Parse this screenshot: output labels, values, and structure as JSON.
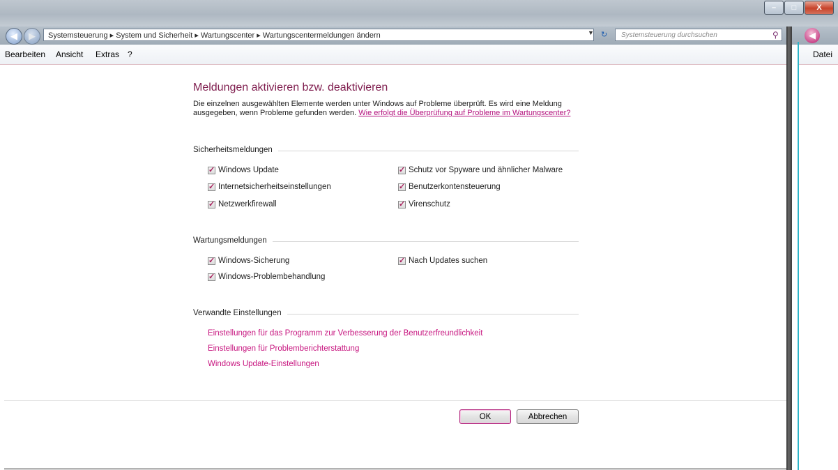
{
  "window": {
    "address_text": "Systemsteuerung  ▸  System und Sicherheit  ▸  Wartungscenter  ▸  Wartungscentermeldungen ändern",
    "search_placeholder": "Systemsteuerung durchsuchen",
    "controls": [
      "–",
      "□",
      "X"
    ]
  },
  "menubar": {
    "items": [
      "Bearbeiten",
      "Ansicht",
      "Extras",
      "?"
    ]
  },
  "right_pane": {
    "menu_label": "Datei"
  },
  "page": {
    "heading": "Meldungen aktivieren bzw. deaktivieren",
    "description": "Die einzelnen ausgewählten Elemente werden unter Windows auf Probleme überprüft. Es wird eine Meldung ausgegeben, wenn Probleme gefunden werden.",
    "help_link": "Wie erfolgt die Überprüfung auf Probleme im Wartungscenter?"
  },
  "security": {
    "title": "Sicherheitsmeldungen",
    "items": [
      {
        "label": "Windows Update",
        "checked": true
      },
      {
        "label": "Schutz vor Spyware und ähnlicher Malware",
        "checked": true
      },
      {
        "label": "Internetsicherheitseinstellungen",
        "checked": true
      },
      {
        "label": "Benutzerkontensteuerung",
        "checked": true
      },
      {
        "label": "Netzwerkfirewall",
        "checked": true
      },
      {
        "label": "Virenschutz",
        "checked": true
      }
    ]
  },
  "maintenance": {
    "title": "Wartungsmeldungen",
    "items": [
      {
        "label": "Windows-Sicherung",
        "checked": true
      },
      {
        "label": "Nach Updates suchen",
        "checked": true
      },
      {
        "label": "Windows-Problembehandlung",
        "checked": true
      }
    ]
  },
  "related": {
    "title": "Verwandte Einstellungen",
    "links": [
      "Einstellungen für das Programm zur Verbesserung der Benutzerfreundlichkeit",
      "Einstellungen für Problemberichterstattung",
      "Windows Update-Einstellungen"
    ]
  },
  "buttons": {
    "ok": "OK",
    "cancel": "Abbrechen"
  },
  "colors": {
    "heading": "#7f1d4e",
    "link": "#c7157f",
    "check": "#a8235e"
  }
}
